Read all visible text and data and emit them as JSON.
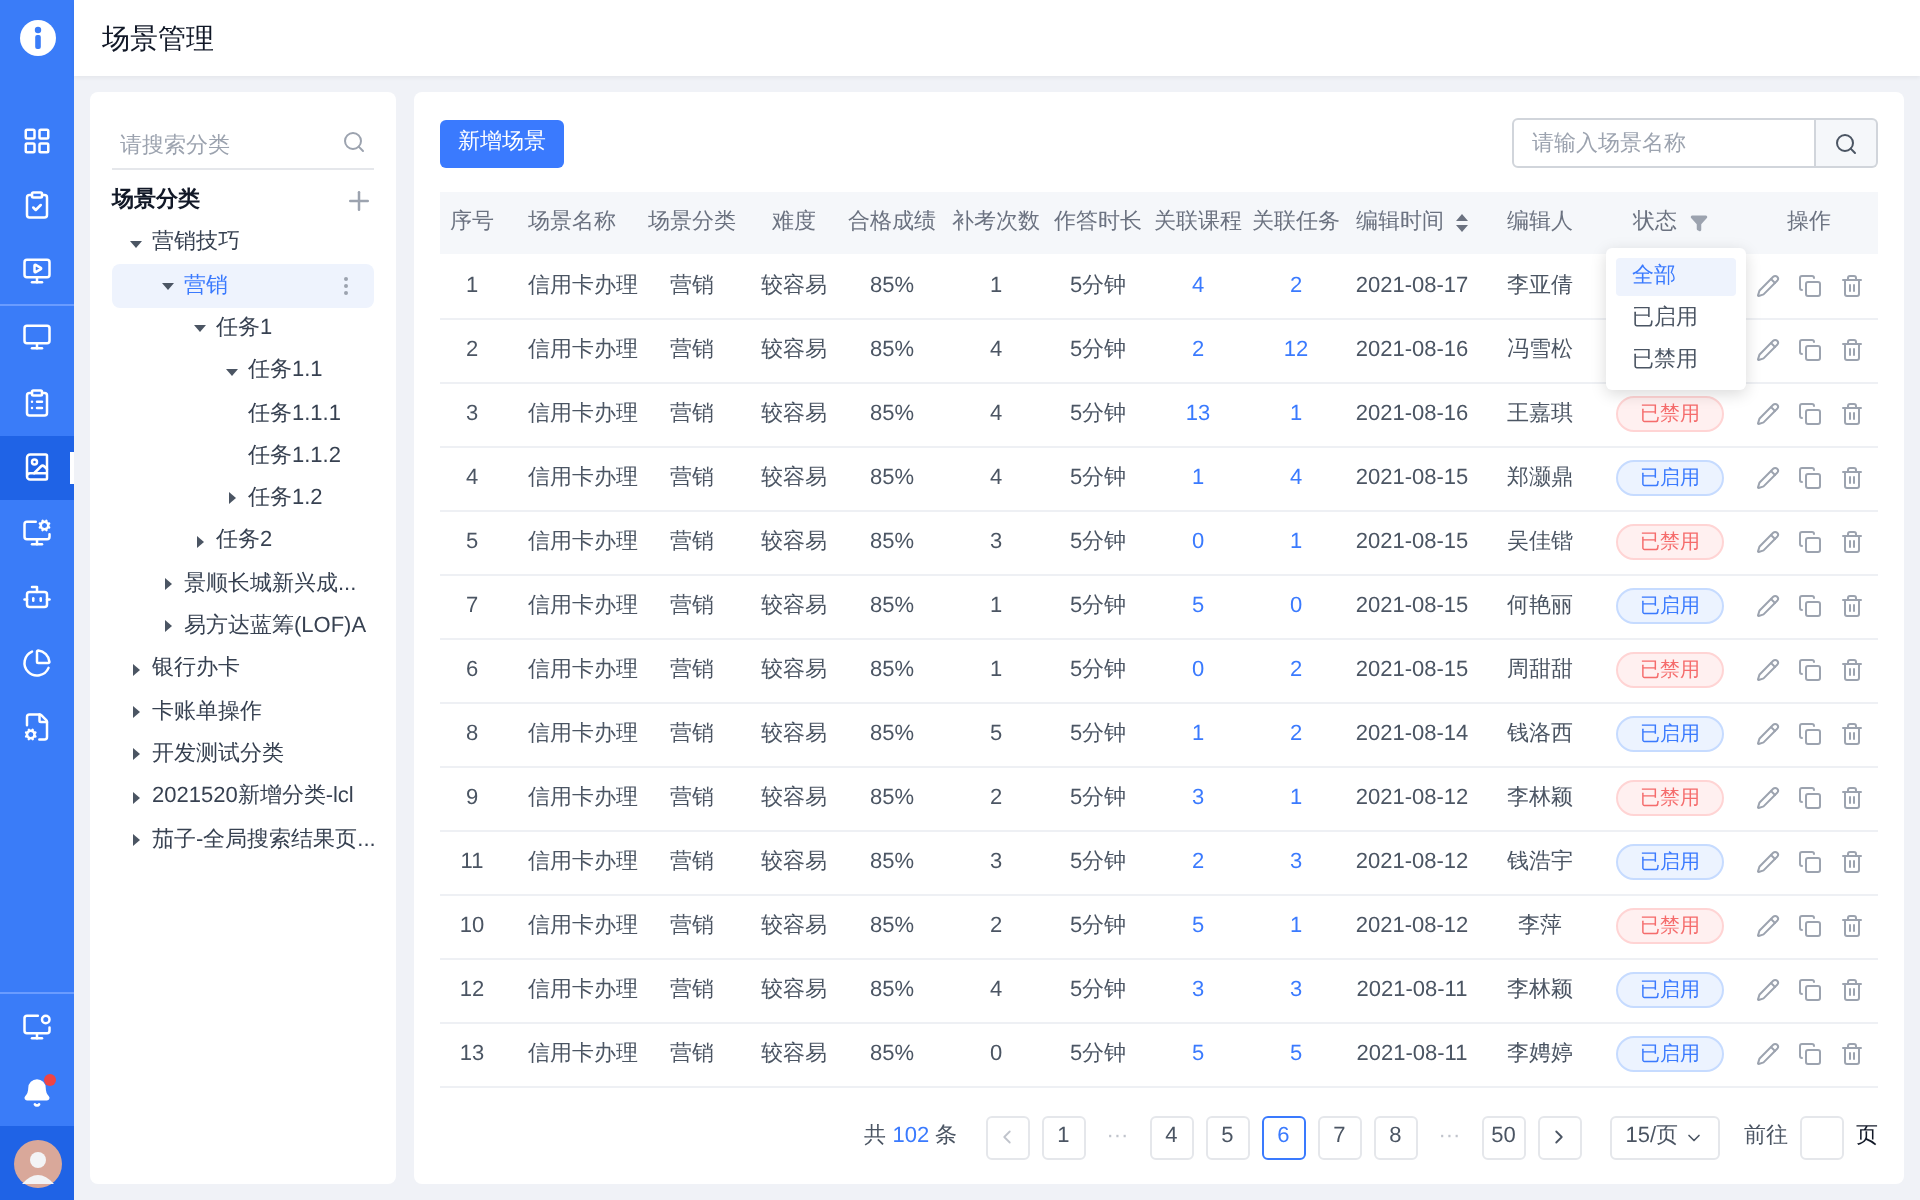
{
  "header": {
    "title": "场景管理"
  },
  "rail": {
    "items": [
      {
        "selected": false
      },
      {
        "selected": false
      },
      {
        "selected": false
      },
      {
        "selected": false
      },
      {
        "selected": false
      },
      {
        "selected": true
      },
      {
        "selected": false
      },
      {
        "selected": false
      },
      {
        "selected": false
      },
      {
        "selected": false
      }
    ]
  },
  "tree": {
    "search": {
      "placeholder": "请搜索分类"
    },
    "title": "场景分类",
    "items": [
      {
        "label": "营销技巧",
        "expanded": true,
        "selected": false,
        "children": [
          {
            "label": "营销",
            "expanded": true,
            "selected": true,
            "children": [
              {
                "label": "任务1",
                "expanded": true,
                "selected": false,
                "children": [
                  {
                    "label": "任务1.1",
                    "expanded": true,
                    "selected": false,
                    "children": [
                      {
                        "label": "任务1.1.1",
                        "selected": false
                      },
                      {
                        "label": "任务1.1.2",
                        "selected": false
                      }
                    ]
                  },
                  {
                    "label": "任务1.2",
                    "expanded": false,
                    "selected": false
                  }
                ]
              },
              {
                "label": "任务2",
                "expanded": false,
                "selected": false
              }
            ]
          },
          {
            "label": "景顺长城新兴成...",
            "expanded": false,
            "selected": false
          },
          {
            "label": "易方达蓝筹(LOF)A",
            "expanded": false,
            "selected": false
          }
        ]
      },
      {
        "label": "银行办卡",
        "expanded": false,
        "selected": false
      },
      {
        "label": "卡账单操作",
        "expanded": false,
        "selected": false
      },
      {
        "label": "开发测试分类",
        "expanded": false,
        "selected": false
      },
      {
        "label": "2021520新增分类-lcl",
        "expanded": false,
        "selected": false
      },
      {
        "label": "茄子-全局搜索结果页...",
        "expanded": false,
        "selected": false
      }
    ]
  },
  "toolbar": {
    "add_button": "新增场景",
    "search": {
      "placeholder": "请输入场景名称"
    }
  },
  "table": {
    "columns": [
      "序号",
      "场景名称",
      "场景分类",
      "难度",
      "合格成绩",
      "补考次数",
      "作答时长",
      "关联课程",
      "关联任务",
      "编辑时间",
      "编辑人",
      "状态",
      "操作"
    ],
    "status_filter": {
      "options": [
        {
          "label": "全部",
          "selected": true
        },
        {
          "label": "已启用",
          "selected": false
        },
        {
          "label": "已禁用",
          "selected": false
        }
      ]
    },
    "rows": [
      {
        "cells": [
          "1",
          "信用卡办理",
          "营销",
          "较容易",
          "85%",
          "1",
          "5分钟",
          "4",
          "2",
          "2021-08-17",
          "李亚倩"
        ]
      },
      {
        "cells": [
          "2",
          "信用卡办理",
          "营销",
          "较容易",
          "85%",
          "4",
          "5分钟",
          "2",
          "12",
          "2021-08-16",
          "冯雪松"
        ]
      },
      {
        "cells": [
          "3",
          "信用卡办理",
          "营销",
          "较容易",
          "85%",
          "4",
          "5分钟",
          "13",
          "1",
          "2021-08-16",
          "王嘉琪"
        ],
        "status": {
          "kind": "disabled",
          "label": "已禁用"
        }
      },
      {
        "cells": [
          "4",
          "信用卡办理",
          "营销",
          "较容易",
          "85%",
          "4",
          "5分钟",
          "1",
          "4",
          "2021-08-15",
          "郑灏鼎"
        ],
        "status": {
          "kind": "enabled",
          "label": "已启用"
        }
      },
      {
        "cells": [
          "5",
          "信用卡办理",
          "营销",
          "较容易",
          "85%",
          "3",
          "5分钟",
          "0",
          "1",
          "2021-08-15",
          "吴佳锴"
        ],
        "status": {
          "kind": "disabled",
          "label": "已禁用"
        }
      },
      {
        "cells": [
          "7",
          "信用卡办理",
          "营销",
          "较容易",
          "85%",
          "1",
          "5分钟",
          "5",
          "0",
          "2021-08-15",
          "何艳丽"
        ],
        "status": {
          "kind": "enabled",
          "label": "已启用"
        }
      },
      {
        "cells": [
          "6",
          "信用卡办理",
          "营销",
          "较容易",
          "85%",
          "1",
          "5分钟",
          "0",
          "2",
          "2021-08-15",
          "周甜甜"
        ],
        "status": {
          "kind": "disabled",
          "label": "已禁用"
        }
      },
      {
        "cells": [
          "8",
          "信用卡办理",
          "营销",
          "较容易",
          "85%",
          "5",
          "5分钟",
          "1",
          "2",
          "2021-08-14",
          "钱洛西"
        ],
        "status": {
          "kind": "enabled",
          "label": "已启用"
        }
      },
      {
        "cells": [
          "9",
          "信用卡办理",
          "营销",
          "较容易",
          "85%",
          "2",
          "5分钟",
          "3",
          "1",
          "2021-08-12",
          "李林颖"
        ],
        "status": {
          "kind": "disabled",
          "label": "已禁用"
        }
      },
      {
        "cells": [
          "11",
          "信用卡办理",
          "营销",
          "较容易",
          "85%",
          "3",
          "5分钟",
          "2",
          "3",
          "2021-08-12",
          "钱浩宇"
        ],
        "status": {
          "kind": "enabled",
          "label": "已启用"
        }
      },
      {
        "cells": [
          "10",
          "信用卡办理",
          "营销",
          "较容易",
          "85%",
          "2",
          "5分钟",
          "5",
          "1",
          "2021-08-12",
          "李萍"
        ],
        "status": {
          "kind": "disabled",
          "label": "已禁用"
        }
      },
      {
        "cells": [
          "12",
          "信用卡办理",
          "营销",
          "较容易",
          "85%",
          "4",
          "5分钟",
          "3",
          "3",
          "2021-08-11",
          "李林颖"
        ],
        "status": {
          "kind": "enabled",
          "label": "已启用"
        }
      },
      {
        "cells": [
          "13",
          "信用卡办理",
          "营销",
          "较容易",
          "85%",
          "0",
          "5分钟",
          "5",
          "5",
          "2021-08-11",
          "李娉婷"
        ],
        "status": {
          "kind": "enabled",
          "label": "已启用"
        }
      }
    ]
  },
  "pagination": {
    "total_prefix": "共",
    "total": "102",
    "total_suffix": "条",
    "pages": [
      {
        "kind": "prev"
      },
      {
        "kind": "page",
        "label": "1",
        "selected": false
      },
      {
        "kind": "ellipsis",
        "label": "···"
      },
      {
        "kind": "page",
        "label": "4",
        "selected": false
      },
      {
        "kind": "page",
        "label": "5",
        "selected": false
      },
      {
        "kind": "page",
        "label": "6",
        "selected": true
      },
      {
        "kind": "page",
        "label": "7",
        "selected": false
      },
      {
        "kind": "page",
        "label": "8",
        "selected": false
      },
      {
        "kind": "ellipsis",
        "label": "···"
      },
      {
        "kind": "page",
        "label": "50",
        "selected": false
      },
      {
        "kind": "next"
      }
    ],
    "page_size": "15/页",
    "goto_label": "前往",
    "goto_suffix": "页"
  }
}
